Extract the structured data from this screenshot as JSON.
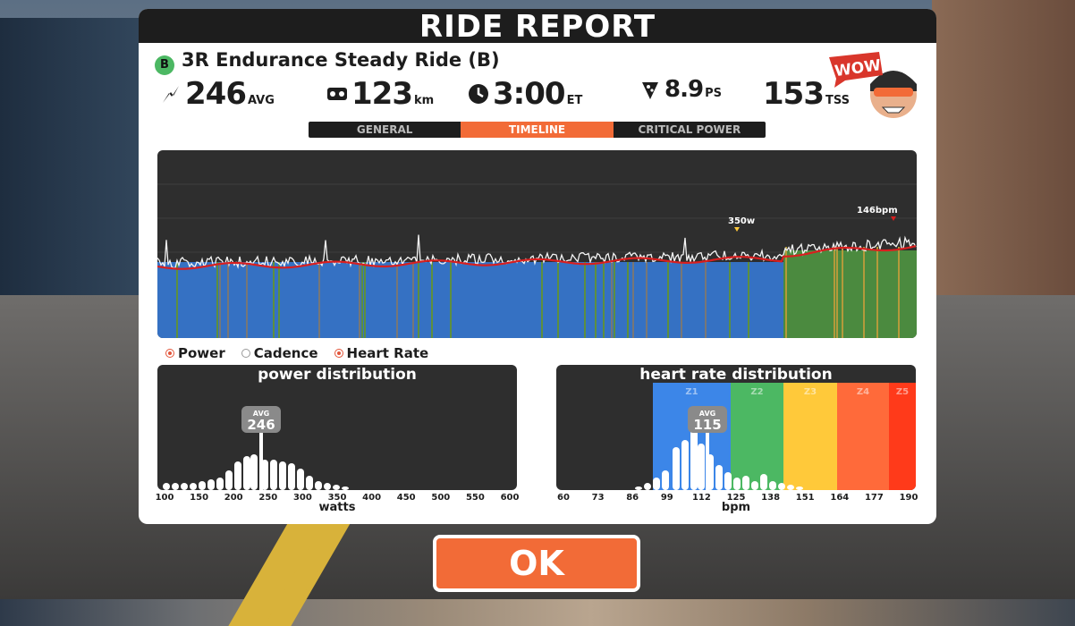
{
  "title": "RIDE REPORT",
  "workout": {
    "level": "B",
    "name": "3R Endurance Steady Ride (B)"
  },
  "stats": [
    {
      "icon": "power-bolt-icon",
      "value": "246",
      "unit": "AVG"
    },
    {
      "icon": "bike-distance-icon",
      "value": "123",
      "unit": "km"
    },
    {
      "icon": "clock-icon",
      "value": "3:00",
      "unit": "ET"
    },
    {
      "icon": "pizza-slice-icon",
      "value": "8.9",
      "unit": "PS"
    },
    {
      "icon": "",
      "value": "153",
      "unit": "TSS"
    }
  ],
  "badge": {
    "text": "WOW!"
  },
  "tabs": [
    {
      "label": "GENERAL",
      "active": false
    },
    {
      "label": "TIMELINE",
      "active": true
    },
    {
      "label": "CRITICAL POWER",
      "active": false
    }
  ],
  "timeline": {
    "peak_power_label": "350w",
    "peak_hr_label": "146bpm"
  },
  "legend": {
    "power": "Power",
    "cadence": "Cadence",
    "heart_rate": "Heart Rate"
  },
  "power_distribution": {
    "title": "power distribution",
    "avg_label": "AVG",
    "avg_value": "246",
    "ticks": [
      "100",
      "150",
      "200",
      "250",
      "300",
      "350",
      "400",
      "450",
      "500",
      "550",
      "600"
    ],
    "unit": "watts"
  },
  "hr_distribution": {
    "title": "heart rate distribution",
    "avg_label": "AVG",
    "avg_value": "115",
    "zones": [
      "Z1",
      "Z2",
      "Z3",
      "Z4",
      "Z5"
    ],
    "zone_colors": [
      "#3c86e8",
      "#4cb863",
      "#ffc93a",
      "#ff6a3a",
      "#ff3a1a"
    ],
    "ticks": [
      "60",
      "73",
      "86",
      "99",
      "112",
      "125",
      "138",
      "151",
      "164",
      "177",
      "190"
    ],
    "unit": "bpm"
  },
  "ok_button": "OK"
}
